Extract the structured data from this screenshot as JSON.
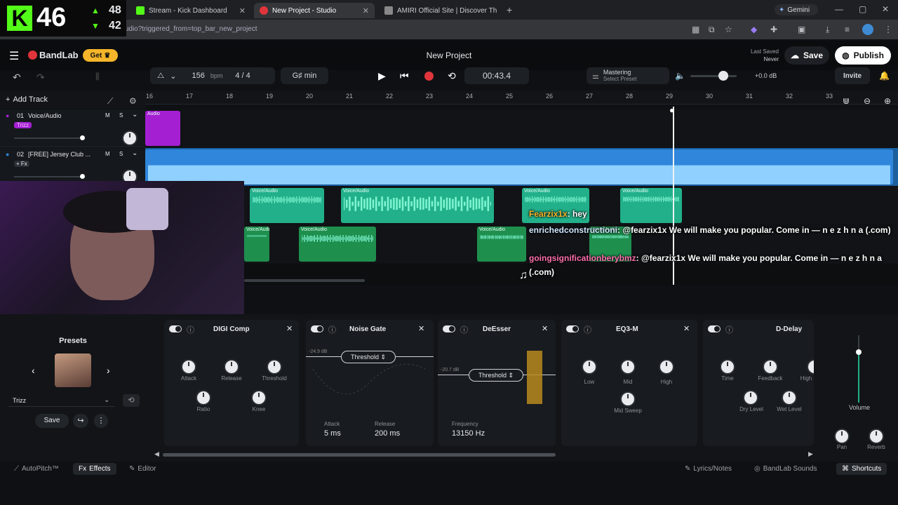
{
  "browser": {
    "tabs": [
      {
        "label": "Stream - Kick Dashboard"
      },
      {
        "label": "New Project - Studio"
      },
      {
        "label": "AMIRI Official Site | Discover Th"
      }
    ],
    "url": "bandlab.com/studio?triggered_from=top_bar_new_project",
    "gemini": "Gemini"
  },
  "overlay": {
    "kick_count": "46",
    "up_count": "48",
    "down_count": "42"
  },
  "app": {
    "brand": "BandLab",
    "get_label": "Get",
    "project_title": "New Project",
    "last_saved_label": "Last Saved",
    "last_saved_value": "Never",
    "save_label": "Save",
    "publish_label": "Publish",
    "invite_label": "Invite"
  },
  "toolbar": {
    "bpm_value": "156",
    "bpm_unit": "bpm",
    "time_sig": "4 / 4",
    "key": "G♯ min",
    "time": "00:43.4",
    "mastering_title": "Mastering",
    "mastering_sub": "Select Preset",
    "gain": "+0.0 dB"
  },
  "tracks": {
    "add_label": "Add Track",
    "list": [
      {
        "num": "01",
        "name": "Voice/Audio",
        "tag": "Trizz"
      },
      {
        "num": "02",
        "name": "[FREE] Jersey Club ...",
        "tag": "+ Fx"
      }
    ],
    "m_label": "M",
    "s_label": "S",
    "ruler": [
      "16",
      "17",
      "18",
      "19",
      "20",
      "21",
      "22",
      "23",
      "24",
      "25",
      "26",
      "27",
      "28",
      "29",
      "30",
      "31",
      "32",
      "33"
    ],
    "clip_label": "Voice/Audio",
    "audio_label": "Audio"
  },
  "chat": [
    {
      "user": "Fearzix1x",
      "message": ": hey"
    },
    {
      "user": "enrichedconstructioni",
      "message": ": @fearzix1x We will make you popular. Come in — n e z h n a (.com)"
    },
    {
      "user": "goingsignificationberybmz",
      "message": ": @fearzix1x We will make you popular. Come in — n e z h n a (.com)"
    }
  ],
  "presets": {
    "title": "Presets",
    "selected": "Trizz",
    "save_label": "Save"
  },
  "effects": [
    {
      "name": "DIGI Comp",
      "knobs": [
        "Attack",
        "Release",
        "Threshold",
        "Ratio",
        "Knee"
      ]
    },
    {
      "name": "Noise Gate",
      "db": "-24.9 dB",
      "threshold": "Threshold",
      "attack_label": "Attack",
      "attack_value": "5 ms",
      "release_label": "Release",
      "release_value": "200 ms"
    },
    {
      "name": "DeEsser",
      "db": "-20.7 dB",
      "threshold": "Threshold",
      "freq_label": "Frequency",
      "freq_value": "13150 Hz"
    },
    {
      "name": "EQ3-M",
      "knobs": [
        "Low",
        "Mid",
        "High",
        "Mid Sweep"
      ]
    },
    {
      "name": "D-Delay",
      "knobs": [
        "Time",
        "Feedback",
        "High",
        "Dry Level",
        "Wet Level"
      ]
    }
  ],
  "master": {
    "volume_label": "Volume",
    "pan_label": "Pan",
    "reverb_label": "Reverb",
    "volume_level": 0.75
  },
  "bottom": {
    "autopitch": "AutoPitch™",
    "effects": "Effects",
    "editor": "Editor",
    "lyrics": "Lyrics/Notes",
    "sounds": "BandLab Sounds",
    "shortcuts": "Shortcuts"
  },
  "colors": {
    "accent_red": "#e0353b",
    "clip_green": "#22b08a",
    "clip_green_dark": "#1f8f4e",
    "beat_blue": "#2f86db",
    "audio_purple": "#a41fd2",
    "get_yellow": "#f5b52a"
  }
}
